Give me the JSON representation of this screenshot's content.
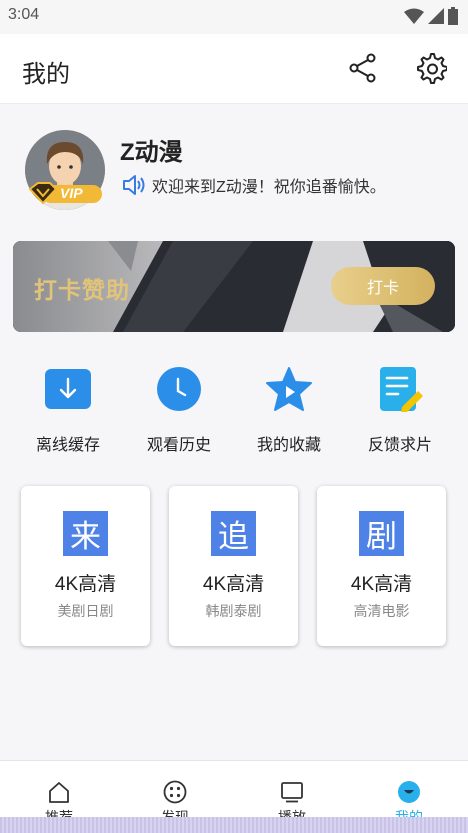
{
  "status": {
    "time": "3:04"
  },
  "appbar": {
    "title": "我的"
  },
  "profile": {
    "name": "Z动漫",
    "welcome": "欢迎来到Z动漫！祝你追番愉快。",
    "vip": "VIP"
  },
  "sponsor": {
    "title": "打卡赞助",
    "button": "打卡"
  },
  "quick_actions": [
    {
      "label": "离线缓存",
      "icon": "download-icon"
    },
    {
      "label": "观看历史",
      "icon": "clock-icon"
    },
    {
      "label": "我的收藏",
      "icon": "star-icon"
    },
    {
      "label": "反馈求片",
      "icon": "note-icon"
    }
  ],
  "cards": [
    {
      "glyph": "来",
      "title": "4K高清",
      "subtitle": "美剧日剧"
    },
    {
      "glyph": "追",
      "title": "4K高清",
      "subtitle": "韩剧泰剧"
    },
    {
      "glyph": "剧",
      "title": "4K高清",
      "subtitle": "高清电影"
    }
  ],
  "tabs": [
    {
      "label": "推荐",
      "icon": "home-icon"
    },
    {
      "label": "发现",
      "icon": "discover-icon"
    },
    {
      "label": "播放",
      "icon": "tv-icon"
    },
    {
      "label": "我的",
      "icon": "profile-icon"
    }
  ],
  "colors": {
    "accent": "#29b0ea",
    "card_glyph": "#4f82e6",
    "gold": "#e2c479",
    "banner": "#2e3038"
  }
}
